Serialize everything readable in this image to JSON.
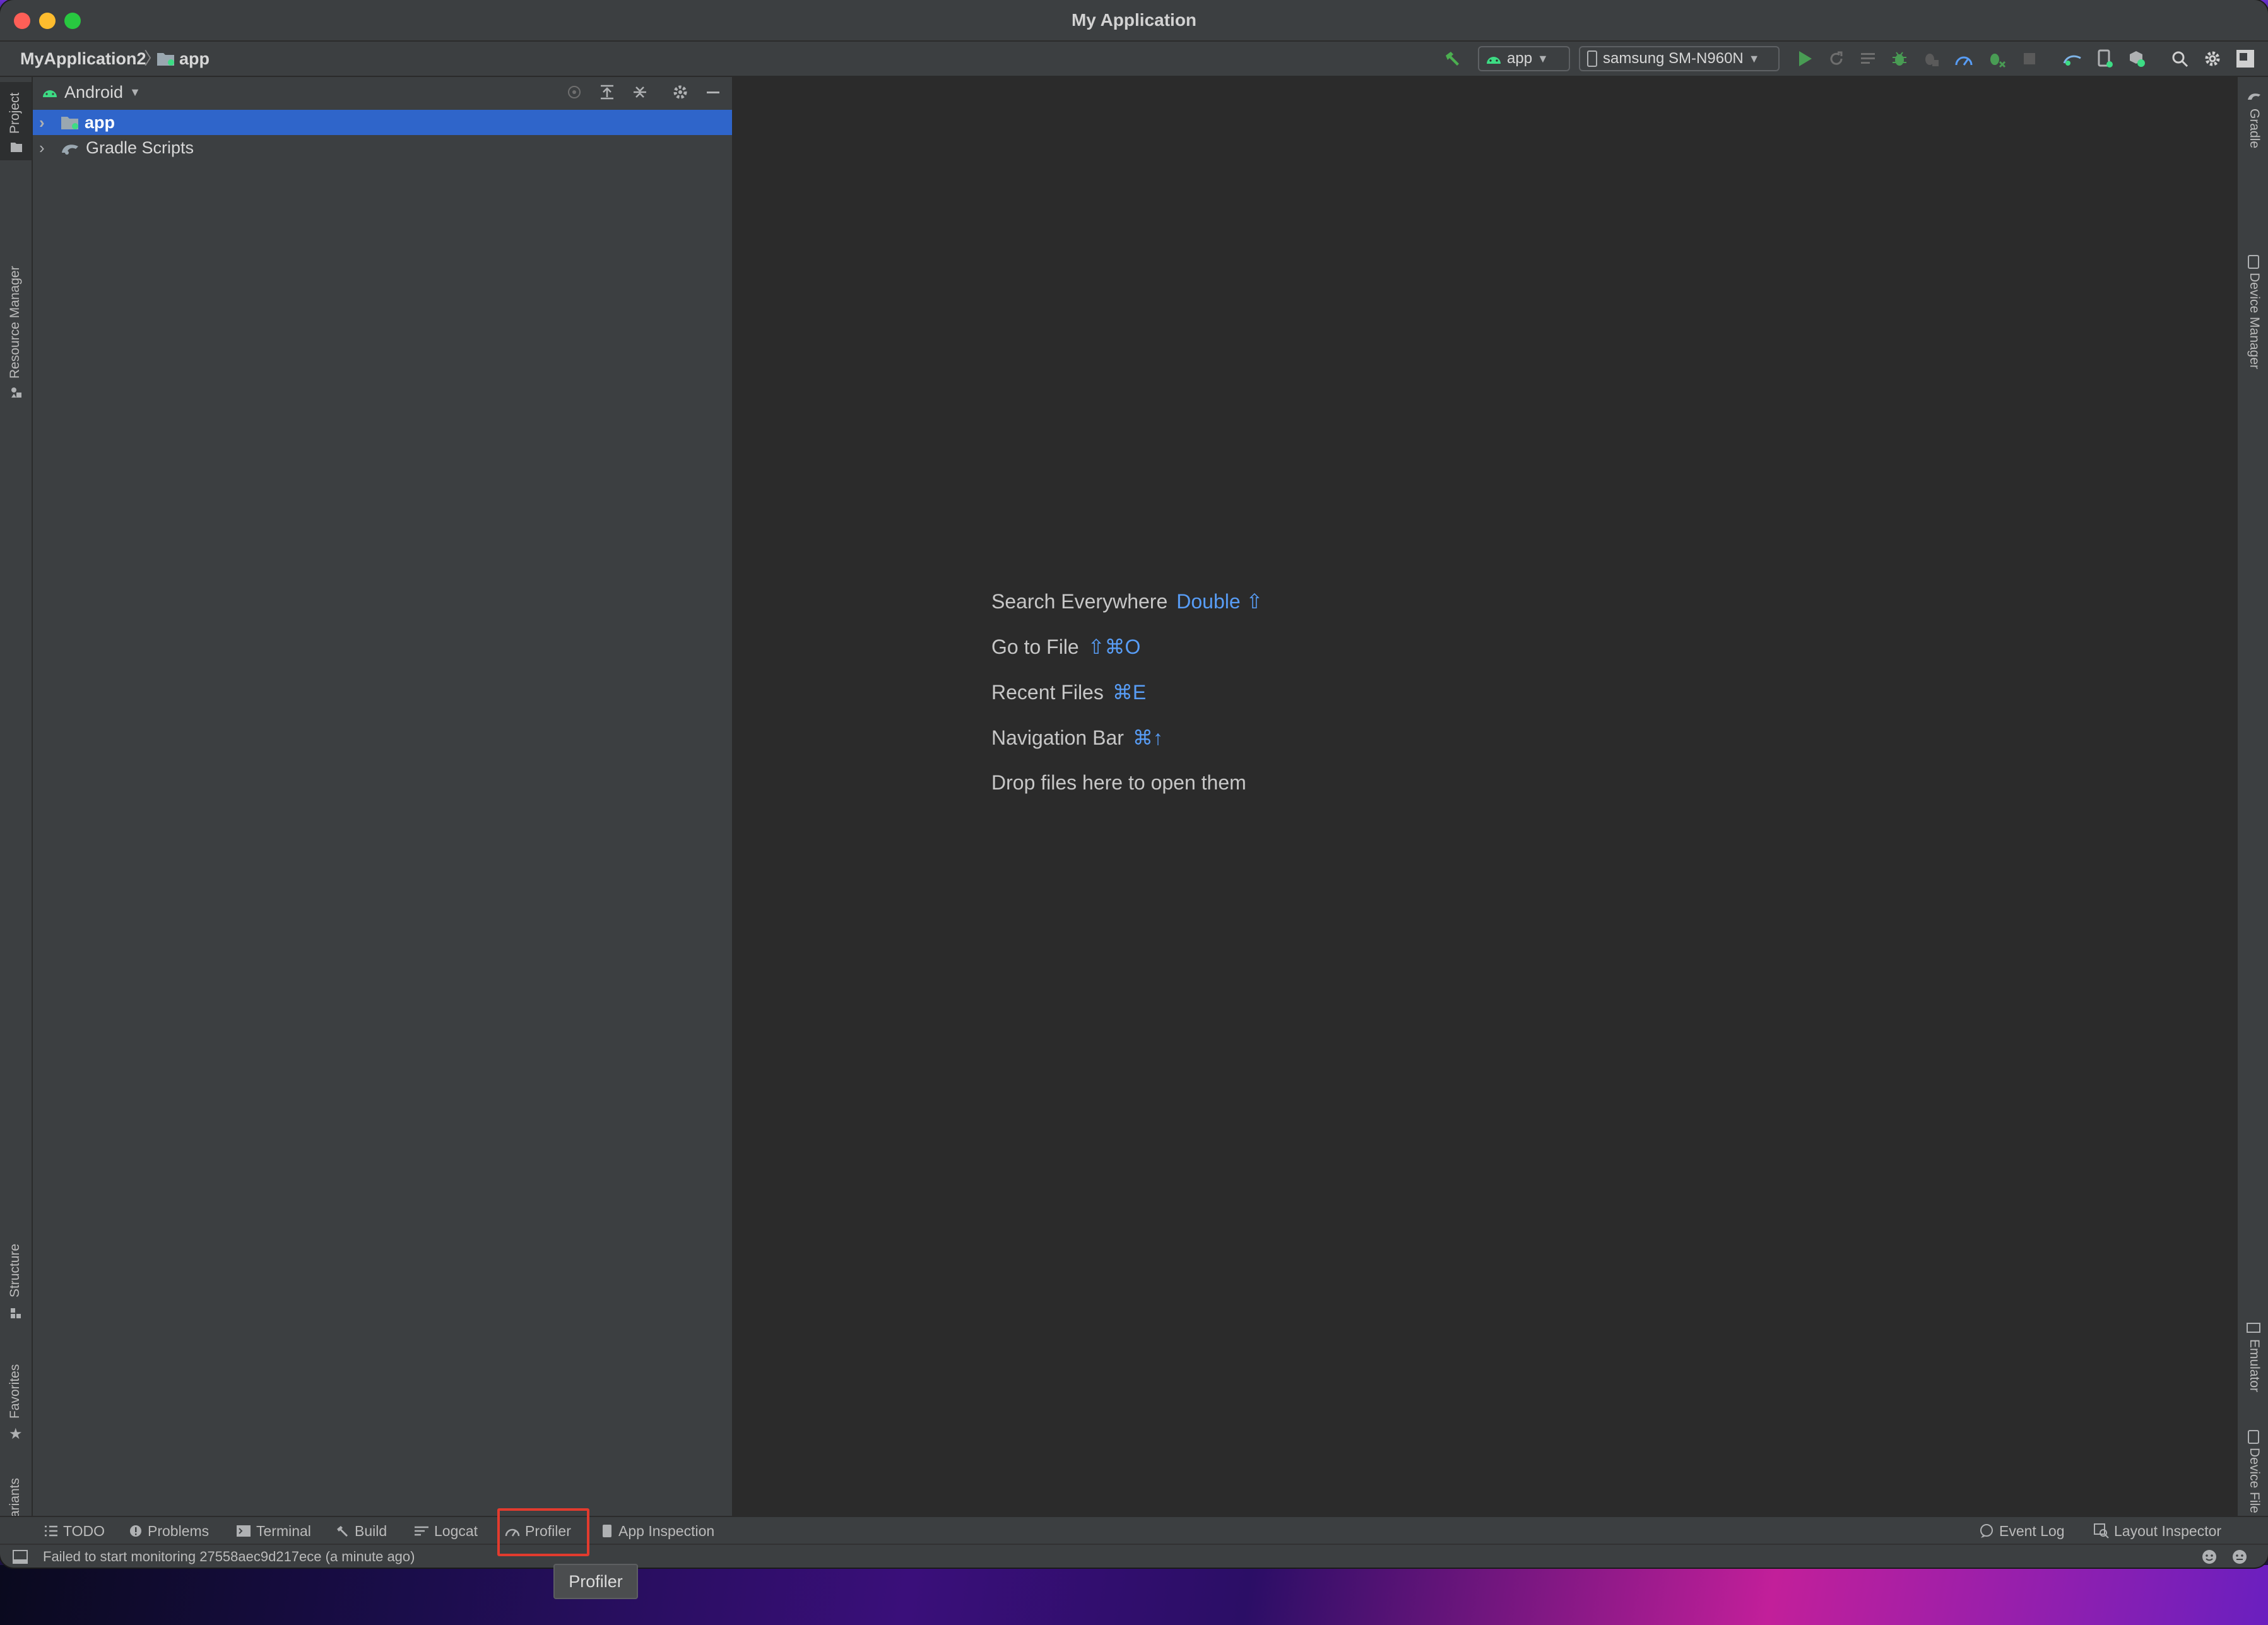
{
  "window": {
    "title": "My Application",
    "traffic_lights": {
      "close": "#fe5f57",
      "minimize": "#febc2e",
      "maximize": "#28c840"
    }
  },
  "navbar": {
    "project": "MyApplication2",
    "module": "app",
    "run_config": "app",
    "device": "samsung SM-N960N",
    "icons": [
      "hammer-icon",
      "run-icon",
      "rerun-icon",
      "apply-changes-icon",
      "debug-icon",
      "attach-debugger-icon",
      "profile-icon",
      "attach-process-icon",
      "stop-icon",
      "sync-gradle-icon",
      "device-manager-icon",
      "sdk-manager-icon",
      "search-icon",
      "settings-icon",
      "account-icon"
    ]
  },
  "left_tabs": {
    "project": "Project",
    "resource_manager": "Resource Manager",
    "structure": "Structure",
    "favorites": "Favorites",
    "build_variants": "Build Variants"
  },
  "right_tabs": {
    "gradle": "Gradle",
    "device_manager": "Device Manager",
    "emulator": "Emulator",
    "device_file_explorer": "Device File Explorer"
  },
  "project_panel": {
    "view": "Android",
    "tree": [
      {
        "label": "app",
        "selected": true
      },
      {
        "label": "Gradle Scripts",
        "selected": false
      }
    ]
  },
  "editor": {
    "hints": [
      {
        "text": "Search Everywhere",
        "shortcut": "Double ⇧"
      },
      {
        "text": "Go to File",
        "shortcut": "⇧⌘O"
      },
      {
        "text": "Recent Files",
        "shortcut": "⌘E"
      },
      {
        "text": "Navigation Bar",
        "shortcut": "⌘↑"
      },
      {
        "text": "Drop files here to open them",
        "shortcut": ""
      }
    ]
  },
  "bottom_tabs": {
    "todo": "TODO",
    "problems": "Problems",
    "terminal": "Terminal",
    "build": "Build",
    "logcat": "Logcat",
    "profiler": "Profiler",
    "app_inspection": "App Inspection",
    "event_log": "Event Log",
    "layout_inspector": "Layout Inspector"
  },
  "status": {
    "message": "Failed to start monitoring 27558aec9d217ece (a minute ago)"
  },
  "tooltip": {
    "text": "Profiler"
  },
  "colors": {
    "selection": "#2f65ca",
    "link_key": "#589df6",
    "android_green": "#3ddc84",
    "highlight_box": "#e23b2e"
  }
}
